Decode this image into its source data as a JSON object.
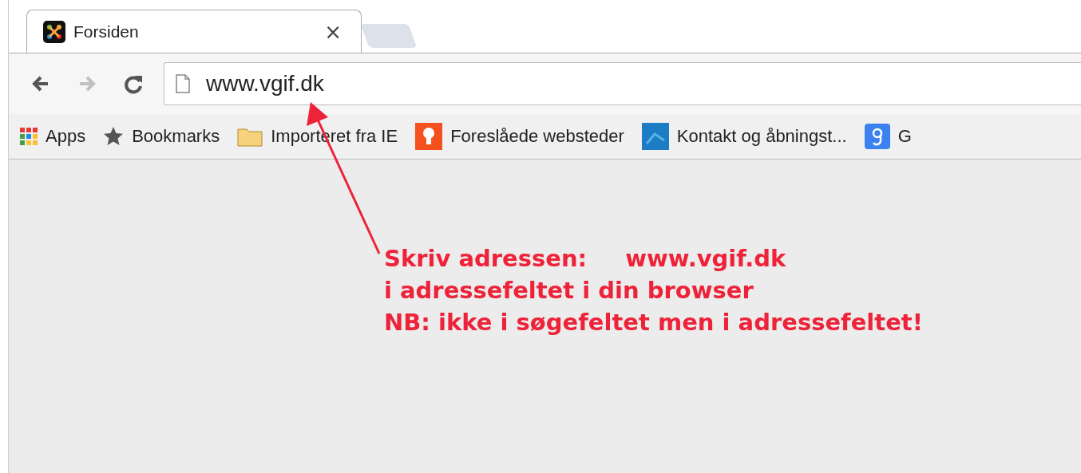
{
  "tabs": [
    {
      "title": "Forsiden",
      "selected": true,
      "close": "×"
    }
  ],
  "address_bar": {
    "value": "www.vgif.dk"
  },
  "navigation": [
    {
      "kind": "back",
      "disabled": false
    },
    {
      "kind": "forward",
      "disabled": true
    },
    {
      "kind": "reload",
      "disabled": false
    }
  ],
  "bookmarks": [
    {
      "kind": "apps",
      "label": "Apps"
    },
    {
      "kind": "star",
      "label": "Bookmarks"
    },
    {
      "kind": "folder",
      "label": "Importeret fra IE"
    },
    {
      "kind": "bulb",
      "label": "Foreslåede websteder"
    },
    {
      "kind": "site",
      "label": "Kontakt og åbningst..."
    },
    {
      "kind": "google",
      "label": "G"
    }
  ],
  "annotation": {
    "label": "Skriv adressen:",
    "value": "www.vgif.dk",
    "lines": [
      "i adressefeltet i din browser",
      "NB: ikke i søgefeltet men i adressefeltet!"
    ]
  }
}
